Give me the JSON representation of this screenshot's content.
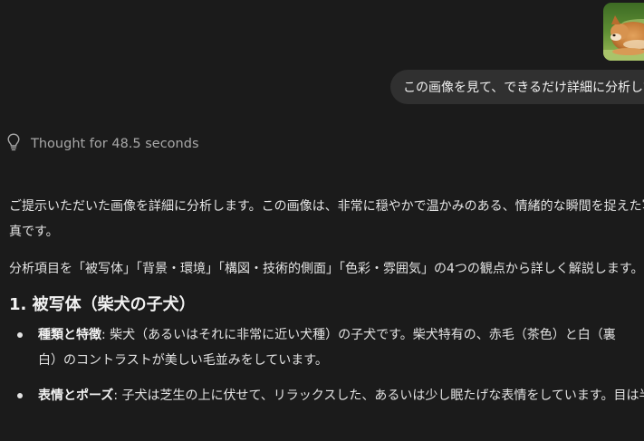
{
  "user_message": {
    "image_alt_icon": "shiba-puppy-photo",
    "text": "この画像を見て、できるだけ詳細に分析して"
  },
  "thought": {
    "icon": "lightbulb-icon",
    "label": "Thought for 48.5 seconds"
  },
  "answer": {
    "intro_line1": "ご提示いただいた画像を詳細に分析します。この画像は、非常に穏やかで温かみのある、情緒的な瞬間を捉えた写",
    "intro_line2": "真です。",
    "outline": "分析項目を「被写体」「背景・環境」「構図・技術的側面」「色彩・雰囲気」の4つの観点から詳しく解説します。",
    "section1_title": "1. 被写体（柴犬の子犬）",
    "bullets": [
      {
        "term": "種類と特徴",
        "text_line1": ": 柴犬（あるいはそれに非常に近い犬種）の子犬です。柴犬特有の、赤毛（茶色）と白（裏",
        "text_line2": "白）のコントラストが美しい毛並みをしています。"
      },
      {
        "term": "表情とポーズ",
        "text_line1": ": 子犬は芝生の上に伏せて、リラックスした、あるいは少し眠たげな表情をしています。目は半分閉"
      }
    ]
  },
  "colors": {
    "background": "#1b1b1b",
    "bubble": "#303030",
    "muted_text": "#a8a8a8",
    "body_text": "#e3e3e3"
  }
}
